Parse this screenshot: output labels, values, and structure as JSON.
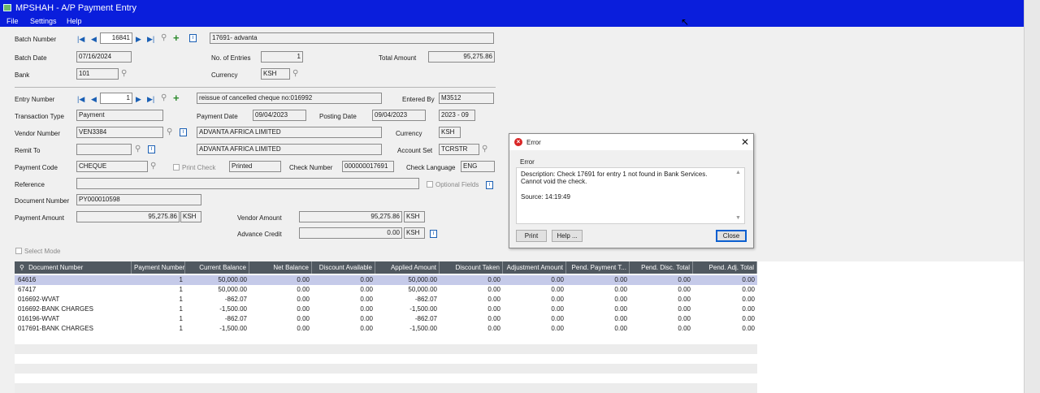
{
  "window": {
    "title": "MPSHAH - A/P Payment Entry"
  },
  "menu": {
    "file": "File",
    "settings": "Settings",
    "help": "Help"
  },
  "batch": {
    "number_label": "Batch Number",
    "number": "16841",
    "description": "17691- advanta",
    "date_label": "Batch Date",
    "date": "07/16/2024",
    "entries_label": "No. of Entries",
    "entries": "1",
    "total_label": "Total Amount",
    "total": "95,275.86",
    "bank_label": "Bank",
    "bank": "101",
    "currency_label": "Currency",
    "currency": "KSH"
  },
  "entry": {
    "number_label": "Entry Number",
    "number": "1",
    "description": "reissue of cancelled cheque no:016992",
    "entered_by_label": "Entered By",
    "entered_by": "M3512",
    "trans_type_label": "Transaction Type",
    "trans_type": "Payment",
    "payment_date_label": "Payment Date",
    "payment_date": "09/04/2023",
    "posting_date_label": "Posting Date",
    "posting_date": "09/04/2023",
    "period": "2023 - 09",
    "vendor_label": "Vendor Number",
    "vendor": "VEN3384",
    "vendor_name": "ADVANTA AFRICA LIMITED",
    "currency_label": "Currency",
    "currency": "KSH",
    "remit_label": "Remit To",
    "remit_name": "ADVANTA AFRICA LIMITED",
    "account_set_label": "Account Set",
    "account_set": "TCRSTR",
    "payment_code_label": "Payment Code",
    "payment_code": "CHEQUE",
    "print_check_label": "Print Check",
    "print_status": "Printed",
    "check_number_label": "Check Number",
    "check_number": "000000017691",
    "check_lang_label": "Check Language",
    "check_lang": "ENG",
    "reference_label": "Reference",
    "optional_label": "Optional Fields",
    "doc_number_label": "Document Number",
    "doc_number": "PY000010598",
    "payment_amount_label": "Payment Amount",
    "payment_amount": "95,275.86",
    "payment_currency": "KSH",
    "vendor_amount_label": "Vendor Amount",
    "vendor_amount": "95,275.86",
    "vendor_currency": "KSH",
    "advance_label": "Advance Credit",
    "advance": "0.00",
    "advance_currency": "KSH",
    "select_mode_label": "Select Mode"
  },
  "grid": {
    "columns": [
      "Document Number",
      "Payment Number",
      "Current Balance",
      "Net Balance",
      "Discount Available",
      "Applied Amount",
      "Discount Taken",
      "Adjustment Amount",
      "Pend. Payment T...",
      "Pend. Disc. Total",
      "Pend. Adj. Total"
    ],
    "rows": [
      [
        "64616",
        "1",
        "50,000.00",
        "0.00",
        "0.00",
        "50,000.00",
        "0.00",
        "0.00",
        "0.00",
        "0.00",
        "0.00"
      ],
      [
        "67417",
        "1",
        "50,000.00",
        "0.00",
        "0.00",
        "50,000.00",
        "0.00",
        "0.00",
        "0.00",
        "0.00",
        "0.00"
      ],
      [
        "016692-WVAT",
        "1",
        "-862.07",
        "0.00",
        "0.00",
        "-862.07",
        "0.00",
        "0.00",
        "0.00",
        "0.00",
        "0.00"
      ],
      [
        "016692-BANK CHARGES",
        "1",
        "-1,500.00",
        "0.00",
        "0.00",
        "-1,500.00",
        "0.00",
        "0.00",
        "0.00",
        "0.00",
        "0.00"
      ],
      [
        "016196-WVAT",
        "1",
        "-862.07",
        "0.00",
        "0.00",
        "-862.07",
        "0.00",
        "0.00",
        "0.00",
        "0.00",
        "0.00"
      ],
      [
        "017691-BANK CHARGES",
        "1",
        "-1,500.00",
        "0.00",
        "0.00",
        "-1,500.00",
        "0.00",
        "0.00",
        "0.00",
        "0.00",
        "0.00"
      ]
    ]
  },
  "dialog": {
    "title": "Error",
    "heading": "Error",
    "description": "Description: Check 17691 for entry 1 not found in Bank Services.  Cannot void the check.",
    "source": "Source:  14:19:49",
    "print": "Print",
    "help": "Help ...",
    "close": "Close"
  },
  "icons": {
    "first": "first-record-icon",
    "prev": "previous-icon",
    "next": "next-icon",
    "last": "last-record-icon",
    "finder": "magnifier-icon",
    "new": "plus-icon",
    "zoom": "zoom-icon",
    "error": "error-icon",
    "close": "close-icon"
  },
  "colors": {
    "titlebar": "#0a1edc",
    "grid_header": "#505860",
    "selected_row": "#c5cae9",
    "error": "#d92626"
  }
}
